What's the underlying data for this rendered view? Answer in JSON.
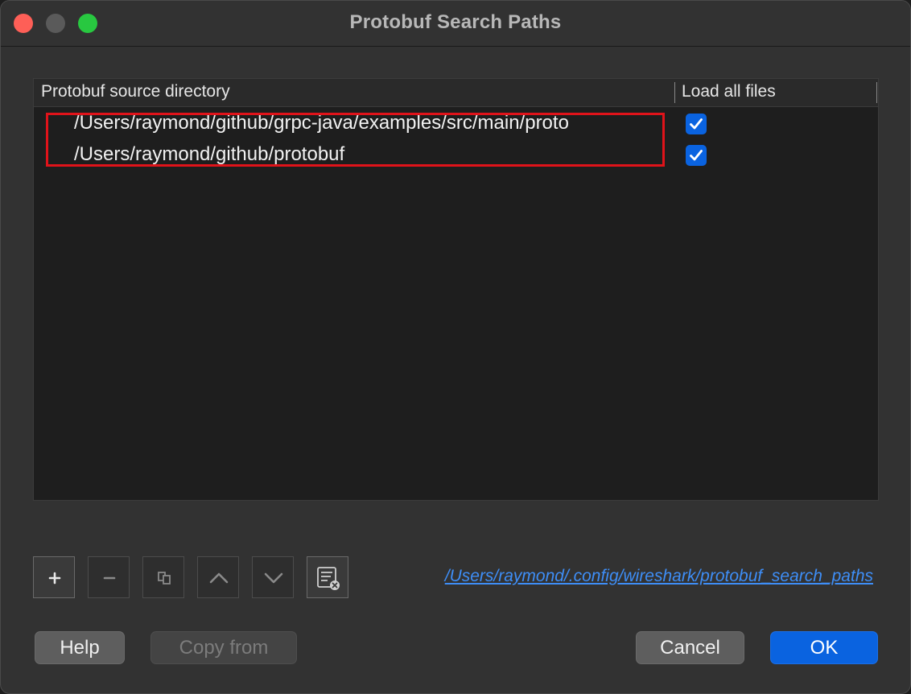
{
  "window": {
    "title": "Protobuf Search Paths"
  },
  "table": {
    "columns": [
      "Protobuf source directory",
      "Load all files"
    ],
    "rows": [
      {
        "path": "/Users/raymond/github/grpc-java/examples/src/main/proto",
        "load_all": true
      },
      {
        "path": "/Users/raymond/github/protobuf",
        "load_all": true
      }
    ]
  },
  "toolbar": {
    "buttons": [
      {
        "name": "add",
        "icon": "plus-icon",
        "enabled": true
      },
      {
        "name": "remove",
        "icon": "minus-icon",
        "enabled": false
      },
      {
        "name": "copy",
        "icon": "copy-icon",
        "enabled": false
      },
      {
        "name": "move-up",
        "icon": "chevron-up-icon",
        "enabled": false
      },
      {
        "name": "move-down",
        "icon": "chevron-down-icon",
        "enabled": false
      },
      {
        "name": "clear",
        "icon": "clear-list-icon",
        "enabled": true
      }
    ],
    "file_path": "/Users/raymond/.config/wireshark/protobuf_search_paths"
  },
  "buttons": {
    "help": "Help",
    "copy_from": "Copy from",
    "cancel": "Cancel",
    "ok": "OK"
  },
  "colors": {
    "accent": "#0a63e0",
    "link": "#3e8ef7",
    "highlight_box": "#e0131a"
  }
}
